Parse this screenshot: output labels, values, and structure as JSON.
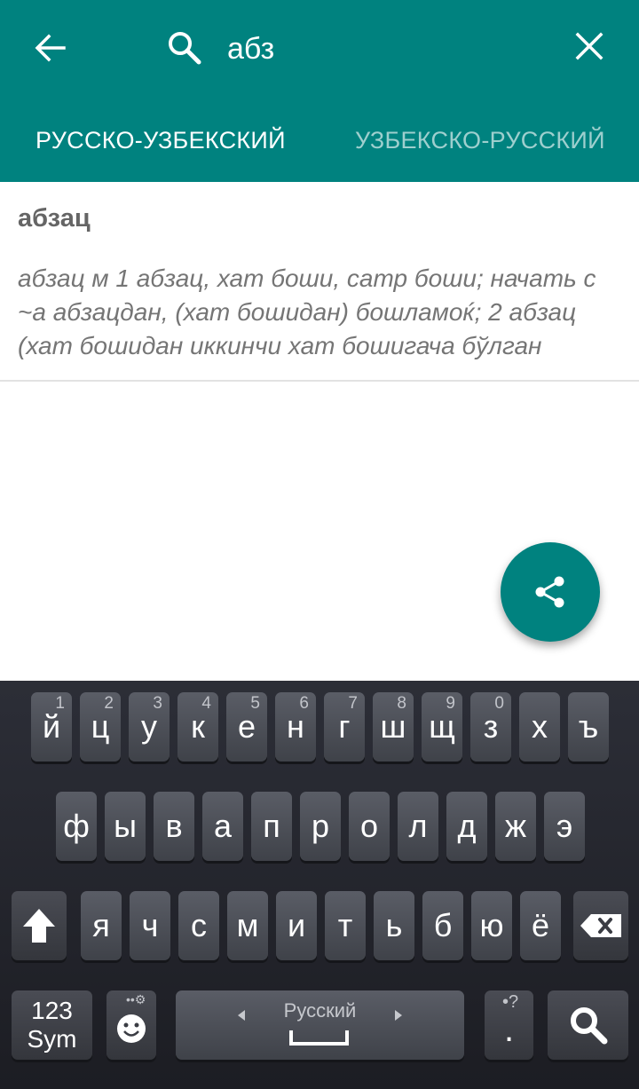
{
  "search": {
    "query": "абз"
  },
  "tabs": [
    {
      "label": "РУССКО-УЗБЕКСКИЙ",
      "active": true
    },
    {
      "label": "УЗБЕКСКО-РУССКИЙ",
      "active": false
    }
  ],
  "entry": {
    "title": "абзац",
    "body": "абзац м 1 абзац, хат боши, сатр боши; начать с ~а абзацдан, (хат бошидан) бошламоќ; 2 абзац (хат бошидан иккинчи хат бошигача бўлган"
  },
  "fab": {
    "icon": "share-icon"
  },
  "keyboard": {
    "row1": [
      {
        "label": "й",
        "num": "1"
      },
      {
        "label": "ц",
        "num": "2"
      },
      {
        "label": "у",
        "num": "3"
      },
      {
        "label": "к",
        "num": "4"
      },
      {
        "label": "е",
        "num": "5"
      },
      {
        "label": "н",
        "num": "6"
      },
      {
        "label": "г",
        "num": "7"
      },
      {
        "label": "ш",
        "num": "8"
      },
      {
        "label": "щ",
        "num": "9"
      },
      {
        "label": "з",
        "num": "0"
      },
      {
        "label": "х",
        "num": ""
      },
      {
        "label": "ъ",
        "num": ""
      }
    ],
    "row2": [
      "ф",
      "ы",
      "в",
      "а",
      "п",
      "р",
      "о",
      "л",
      "д",
      "ж",
      "э"
    ],
    "row3": [
      "я",
      "ч",
      "с",
      "м",
      "и",
      "т",
      "ь",
      "б",
      "ю",
      "ё"
    ],
    "sym_line1": "123",
    "sym_line2": "Sym",
    "space_label": "Русский",
    "period": ".",
    "period_hint": "•?"
  },
  "colors": {
    "accent": "#00827f",
    "keyboard_bg": "#26272e"
  }
}
